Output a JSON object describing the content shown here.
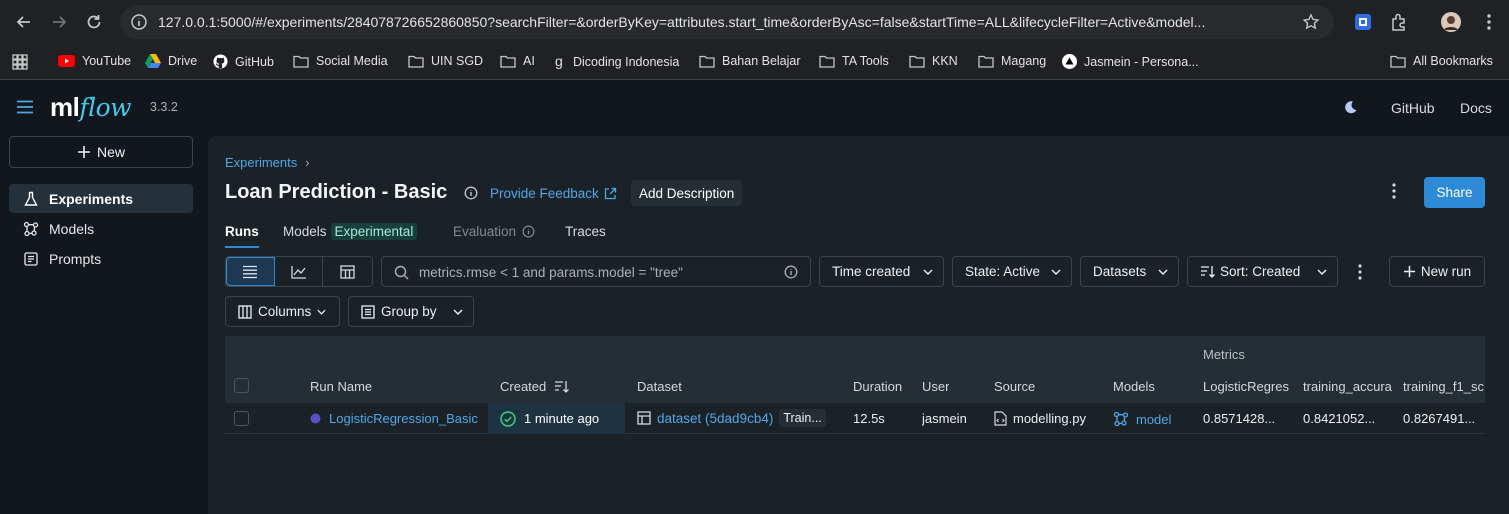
{
  "browser": {
    "url": "127.0.0.1:5000/#/experiments/284078726652860850?searchFilter=&orderByKey=attributes.start_time&orderByAsc=false&startTime=ALL&lifecycleFilter=Active&model...",
    "bookmarks": [
      "YouTube",
      "Drive",
      "GitHub",
      "Social Media",
      "UIN SGD",
      "AI",
      "Dicoding Indonesia",
      "Bahan Belajar",
      "TA Tools",
      "KKN",
      "Magang",
      "Jasmein - Persona...",
      "All Bookmarks"
    ]
  },
  "header": {
    "logo_ml": "ml",
    "logo_flow": "flow",
    "version": "3.3.2",
    "github": "GitHub",
    "docs": "Docs"
  },
  "sidebar": {
    "new_label": "New",
    "items": [
      {
        "label": "Experiments",
        "icon": "beaker-icon",
        "active": true
      },
      {
        "label": "Models",
        "icon": "models-icon",
        "active": false
      },
      {
        "label": "Prompts",
        "icon": "prompt-icon",
        "active": false
      }
    ]
  },
  "main": {
    "breadcrumb": "Experiments",
    "breadcrumb_sep": "›",
    "title": "Loan Prediction - Basic",
    "feedback": "Provide Feedback",
    "add_description": "Add Description",
    "share": "Share",
    "tabs": [
      {
        "label": "Runs"
      },
      {
        "label": "Models",
        "badge": "Experimental"
      },
      {
        "label": "Evaluation"
      },
      {
        "label": "Traces"
      }
    ],
    "search_placeholder": "metrics.rmse < 1 and params.model = \"tree\"",
    "filters": {
      "time": "Time created",
      "state": "State: Active",
      "datasets": "Datasets",
      "sort": "Sort: Created",
      "new_run": "New run",
      "columns": "Columns",
      "group_by": "Group by"
    }
  },
  "table": {
    "group_header": "Metrics",
    "columns": [
      "Run Name",
      "Created",
      "Dataset",
      "Duration",
      "User",
      "Source",
      "Models",
      "LogisticRegres",
      "training_accura",
      "training_f1_sc"
    ],
    "rows": [
      {
        "run_name": "LogisticRegression_Basic",
        "created": "1 minute ago",
        "dataset": "dataset (5dad9cb4)",
        "dataset_tag": "Train...",
        "duration": "12.5s",
        "user": "jasmein",
        "source": "modelling.py",
        "model": "model",
        "m1": "0.8571428...",
        "m2": "0.8421052...",
        "m3": "0.8267491..."
      }
    ]
  },
  "colors": {
    "accent": "#2d8ad6",
    "link": "#4fa8e6",
    "success": "#3ccf7a",
    "run_dot": "#5b4fc4"
  }
}
